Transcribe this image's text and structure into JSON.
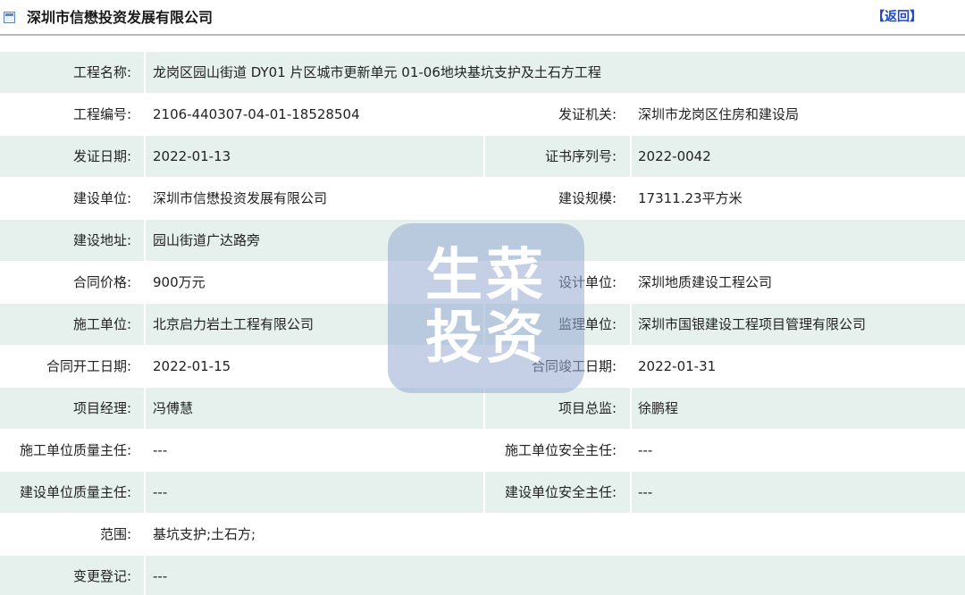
{
  "header": {
    "title": "深圳市信懋投资发展有限公司",
    "back_label": "【返回】"
  },
  "rows": [
    {
      "l1": "工程名称:",
      "v1": "龙岗区园山街道 DY01 片区城市更新单元 01-06地块基坑支护及土石方工程",
      "l2": "",
      "v2": ""
    },
    {
      "l1": "工程编号:",
      "v1": "2106-440307-04-01-18528504",
      "l2": "发证机关:",
      "v2": "深圳市龙岗区住房和建设局"
    },
    {
      "l1": "发证日期:",
      "v1": "2022-01-13",
      "l2": "证书序列号:",
      "v2": "2022-0042"
    },
    {
      "l1": "建设单位:",
      "v1": "深圳市信懋投资发展有限公司",
      "l2": "建设规模:",
      "v2": "17311.23平方米"
    },
    {
      "l1": "建设地址:",
      "v1": "园山街道广达路旁",
      "l2": "",
      "v2": ""
    },
    {
      "l1": "合同价格:",
      "v1": "900万元",
      "l2": "设计单位:",
      "v2": "深圳地质建设工程公司"
    },
    {
      "l1": "施工单位:",
      "v1": "北京启力岩土工程有限公司",
      "l2": "监理单位:",
      "v2": "深圳市国银建设工程项目管理有限公司"
    },
    {
      "l1": "合同开工日期:",
      "v1": "2022-01-15",
      "l2": "合同竣工日期:",
      "v2": "2022-01-31"
    },
    {
      "l1": "项目经理:",
      "v1": "冯傅慧",
      "l2": "项目总监:",
      "v2": "徐鹏程"
    },
    {
      "l1": "施工单位质量主任:",
      "v1": "---",
      "l2": "施工单位安全主任:",
      "v2": "---"
    },
    {
      "l1": "建设单位质量主任:",
      "v1": "---",
      "l2": "建设单位安全主任:",
      "v2": "---"
    },
    {
      "l1": "范围:",
      "v1": "基坑支护;土石方;",
      "l2": "",
      "v2": ""
    },
    {
      "l1": "变更登记:",
      "v1": "---",
      "l2": "",
      "v2": ""
    }
  ],
  "watermark": {
    "line1": "生菜",
    "line2": "投资"
  },
  "colors": {
    "row_alt": "#e6f1ee",
    "link": "#1f48c8",
    "watermark_bg": "#96aad2"
  },
  "icons": {
    "title_icon": "window-icon"
  }
}
